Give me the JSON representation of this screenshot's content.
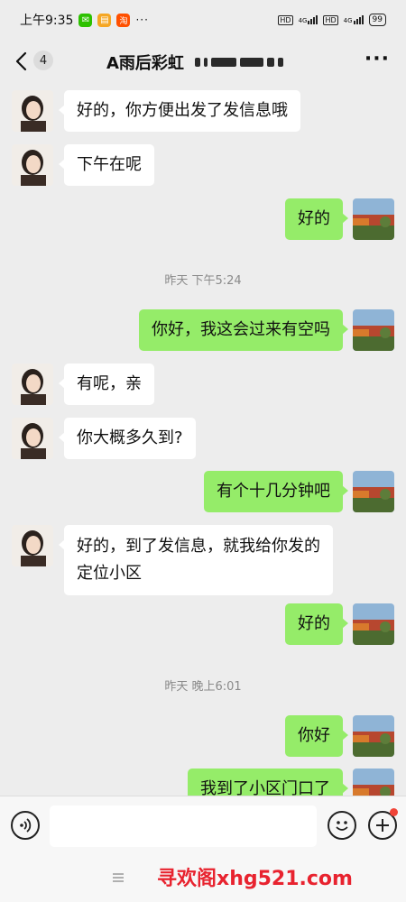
{
  "status_bar": {
    "time": "上午9:35",
    "apps": [
      {
        "icon": "wechat-icon",
        "color": "#2dc100",
        "glyph": "✉"
      },
      {
        "icon": "notes-icon",
        "color": "#f5a623",
        "glyph": "▤"
      },
      {
        "icon": "taobao-icon",
        "color": "#ff5000",
        "glyph": "淘"
      }
    ],
    "more": "···",
    "hd1": "HD",
    "net1": "4G",
    "hd2": "HD",
    "net2": "4G",
    "battery": "99"
  },
  "nav": {
    "unread_count": "4",
    "title": "A雨后彩虹",
    "more_label": "···"
  },
  "messages": [
    {
      "side": "in",
      "text": "好的，你方便出发了发信息哦"
    },
    {
      "side": "in",
      "text": "下午在呢"
    },
    {
      "side": "out",
      "text": "好的"
    },
    {
      "side": "time",
      "text": "昨天 下午5:24"
    },
    {
      "side": "out",
      "text": "你好，我这会过来有空吗"
    },
    {
      "side": "in",
      "text": "有呢，亲"
    },
    {
      "side": "in",
      "text": "你大概多久到?"
    },
    {
      "side": "out",
      "text": "有个十几分钟吧"
    },
    {
      "side": "in",
      "text_lines": [
        "好的，到了发信息，就我给你发的",
        "定位小区"
      ]
    },
    {
      "side": "out",
      "text": "好的"
    },
    {
      "side": "time",
      "text": "昨天 晚上6:01"
    },
    {
      "side": "out",
      "text": "你好"
    },
    {
      "side": "out",
      "text": "我到了小区门口了"
    }
  ],
  "input": {
    "value": "",
    "placeholder": ""
  },
  "watermark": "寻欢阁xhg521.com",
  "colors": {
    "background": "#ededed",
    "incoming_bubble": "#ffffff",
    "outgoing_bubble": "#95ec69",
    "badge": "#f04438",
    "watermark": "#e8232f"
  }
}
